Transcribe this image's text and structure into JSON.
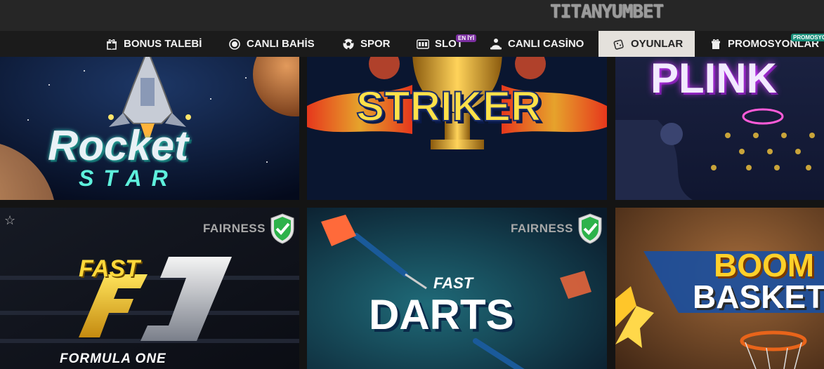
{
  "header": {
    "logo": "TITANYUMBET"
  },
  "nav": {
    "items": [
      {
        "label": "BONUS TALEBİ",
        "icon": "gift-icon"
      },
      {
        "label": "CANLI BAHİS",
        "icon": "live-dot-icon"
      },
      {
        "label": "SPOR",
        "icon": "soccer-ball-icon"
      },
      {
        "label": "SLOT",
        "icon": "slot-machine-icon",
        "badge": "EN İYİ"
      },
      {
        "label": "CANLI CASİNO",
        "icon": "dealer-icon"
      },
      {
        "label": "OYUNLAR",
        "icon": "dice-icon",
        "active": true
      },
      {
        "label": "PROMOSYONLAR",
        "icon": "promo-icon",
        "badge": "PROMOSYO"
      }
    ]
  },
  "games": {
    "fairness_label": "FAIRNESS",
    "tiles": [
      {
        "title": "Rocket",
        "subtitle": "STAR"
      },
      {
        "title": "STRIKER"
      },
      {
        "title": "PLINK"
      },
      {
        "title": "FAST",
        "subtitle": "FORMULA ONE",
        "fairness": true
      },
      {
        "title": "DARTS",
        "kicker": "FAST",
        "fairness": true
      },
      {
        "title": "BOOM",
        "subtitle": "BASKET"
      }
    ]
  },
  "colors": {
    "active_tab": "#e4e1dc",
    "badge_purple": "#7b2fa0",
    "badge_teal": "#1a8f7a",
    "fair_green": "#2db24a"
  }
}
